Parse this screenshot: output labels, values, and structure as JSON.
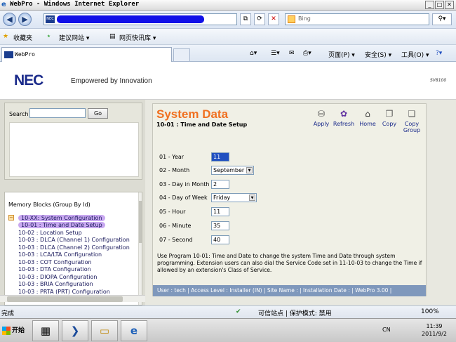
{
  "window": {
    "title": "WebPro - Windows Internet Explorer"
  },
  "address_bar": {
    "search_placeholder": "Bing"
  },
  "favorites_bar": {
    "favorites": "收藏夹",
    "suggested_sites": "建议网站 ▾",
    "web_slice": "网页快讯库 ▾"
  },
  "tab": {
    "title": "WebPro"
  },
  "command_bar": {
    "page": "页面(P) ▾",
    "safety": "安全(S) ▾",
    "tools": "工具(O) ▾"
  },
  "brand": {
    "logo": "NEC",
    "tagline": "Empowered by Innovation",
    "model": "SV8100"
  },
  "search_panel": {
    "label": "Search",
    "go": "Go"
  },
  "memory_blocks": {
    "heading": "Memory Blocks (Group By Id)",
    "items": [
      "10-XX: System Configuration",
      "10-01 : Time and Date Setup",
      "10-02 : Location Setup",
      "10-03 : DLCA (Channel 1) Configuration",
      "10-03 : DLCA (Channel 2) Configuration",
      "10-03 : LCA/LTA Configuration",
      "10-03 : COT Configuration",
      "10-03 : DTA Configuration",
      "10-03 : DIOPA Configuration",
      "10-03 : BRIA Configuration",
      "10-03 : PRTA (PRT) Configuration"
    ]
  },
  "main": {
    "title": "System Data",
    "subtitle": "10-01 : Time and Date Setup",
    "tools": [
      "Apply",
      "Refresh",
      "Home",
      "Copy",
      "Copy Group"
    ],
    "fields": {
      "year": {
        "label": "01 - Year",
        "value": "11"
      },
      "month": {
        "label": "02 - Month",
        "value": "September"
      },
      "day": {
        "label": "03 - Day in Month",
        "value": "2"
      },
      "dow": {
        "label": "04 - Day of Week",
        "value": "Friday"
      },
      "hour": {
        "label": "05 - Hour",
        "value": "11"
      },
      "minute": {
        "label": "06 - Minute",
        "value": "35"
      },
      "second": {
        "label": "07 - Second",
        "value": "40"
      }
    },
    "description": "Use Program 10-01: Time and Date to change the system Time and Date through system programming. Extension users can also dial the Service Code set in 11-10-03 to change the Time if allowed by an extension's Class of Service.",
    "status": "User : tech | Access Level : Installer (IN) | Site Name : | Installation Date : | WebPro 3.00 |"
  },
  "ie_status": {
    "left": "完成",
    "zone": "可信站点 | 保护模式: 禁用",
    "zoom": "100%"
  },
  "taskbar": {
    "start": "开始",
    "lang": "CN",
    "time": "11:39",
    "date": "2011/9/2"
  }
}
